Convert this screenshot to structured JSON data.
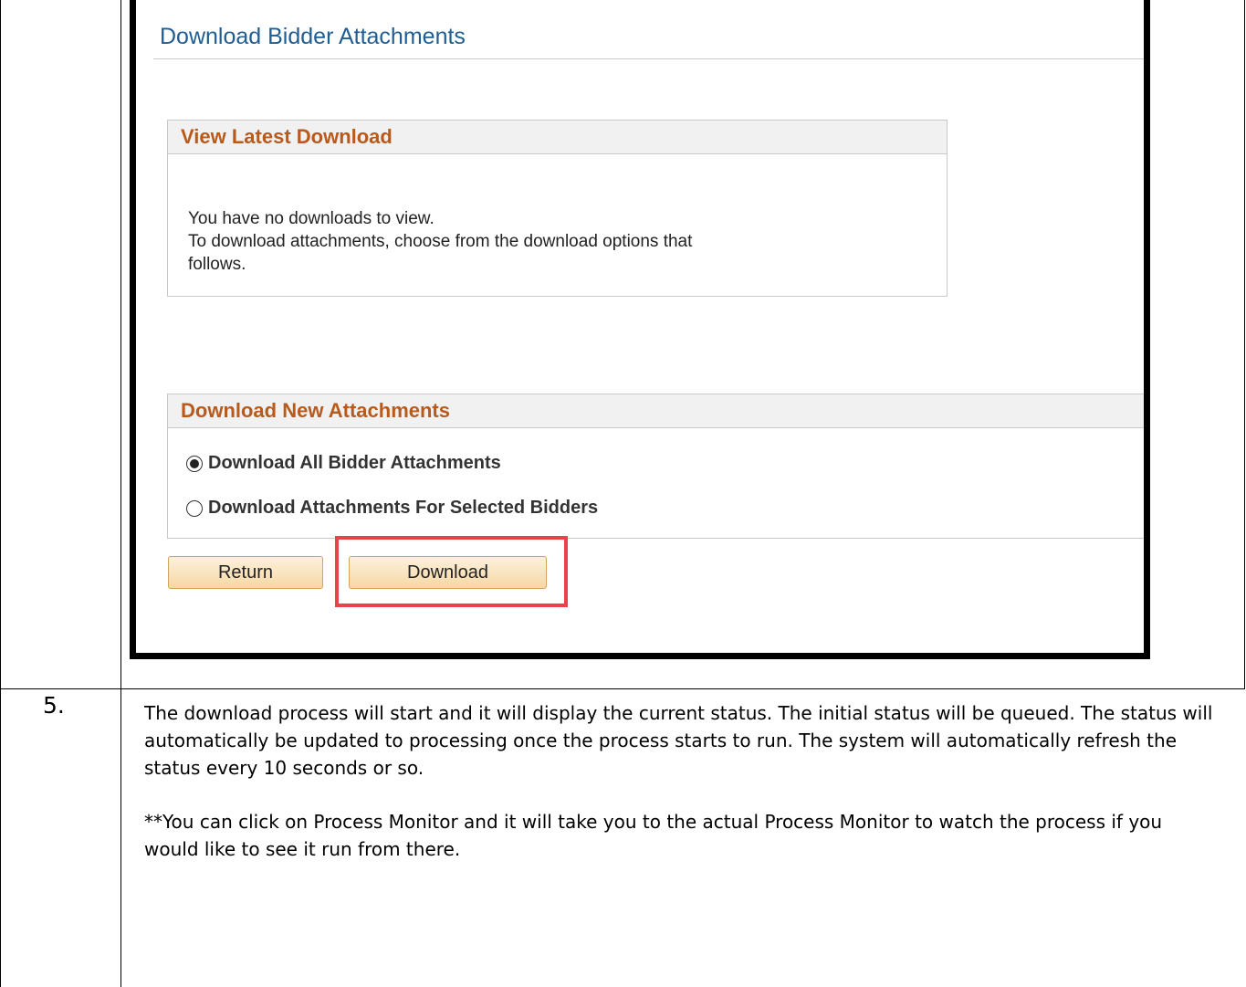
{
  "screenshot": {
    "page_title": "Download Bidder Attachments",
    "latest_download": {
      "header": "View Latest Download",
      "message_line1": "You have no downloads to view.",
      "message_line2": "To download attachments, choose from the download options that",
      "message_line3": "follows."
    },
    "new_attachments": {
      "header": "Download New Attachments",
      "options": [
        {
          "label": "Download All Bidder Attachments",
          "selected": true
        },
        {
          "label": "Download Attachments For Selected Bidders",
          "selected": false
        }
      ]
    },
    "buttons": {
      "return_label": "Return",
      "download_label": "Download"
    },
    "highlight_color": "#e8424a",
    "header_color": "#b85a1c",
    "title_color": "#1f5d92"
  },
  "step": {
    "number": "5.",
    "paragraph1": "The download process will start and it will display the current status. The initial status will be queued. The status will automatically be updated to processing once the process starts to run.  The system will automatically refresh the status every 10 seconds or so.",
    "paragraph2": "**You can click on Process Monitor and it will take you to the actual Process Monitor to watch the process if you would like to see it run from there."
  }
}
